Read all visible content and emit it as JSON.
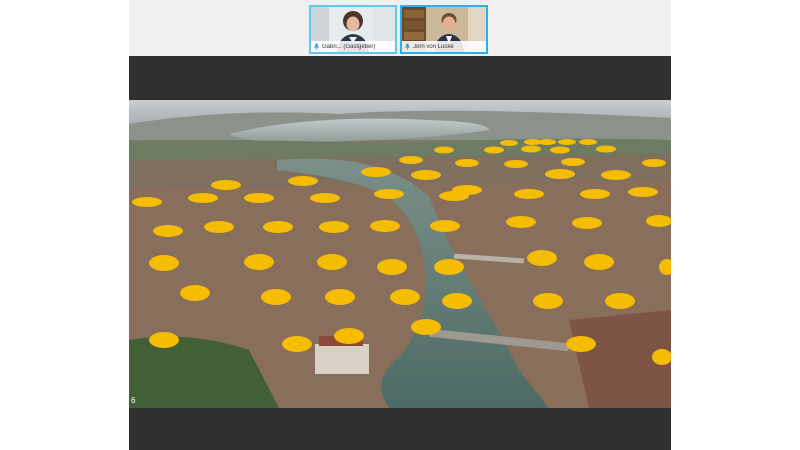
{
  "participants": [
    {
      "name": "Gabri... (Gastgeber)",
      "mic_icon": "mic-icon",
      "active": false
    },
    {
      "name": "Jörn von Lucke",
      "mic_icon": "mic-icon",
      "active": true
    }
  ],
  "slide": {
    "page_number": "6",
    "marker_color": "#f5bd02"
  }
}
